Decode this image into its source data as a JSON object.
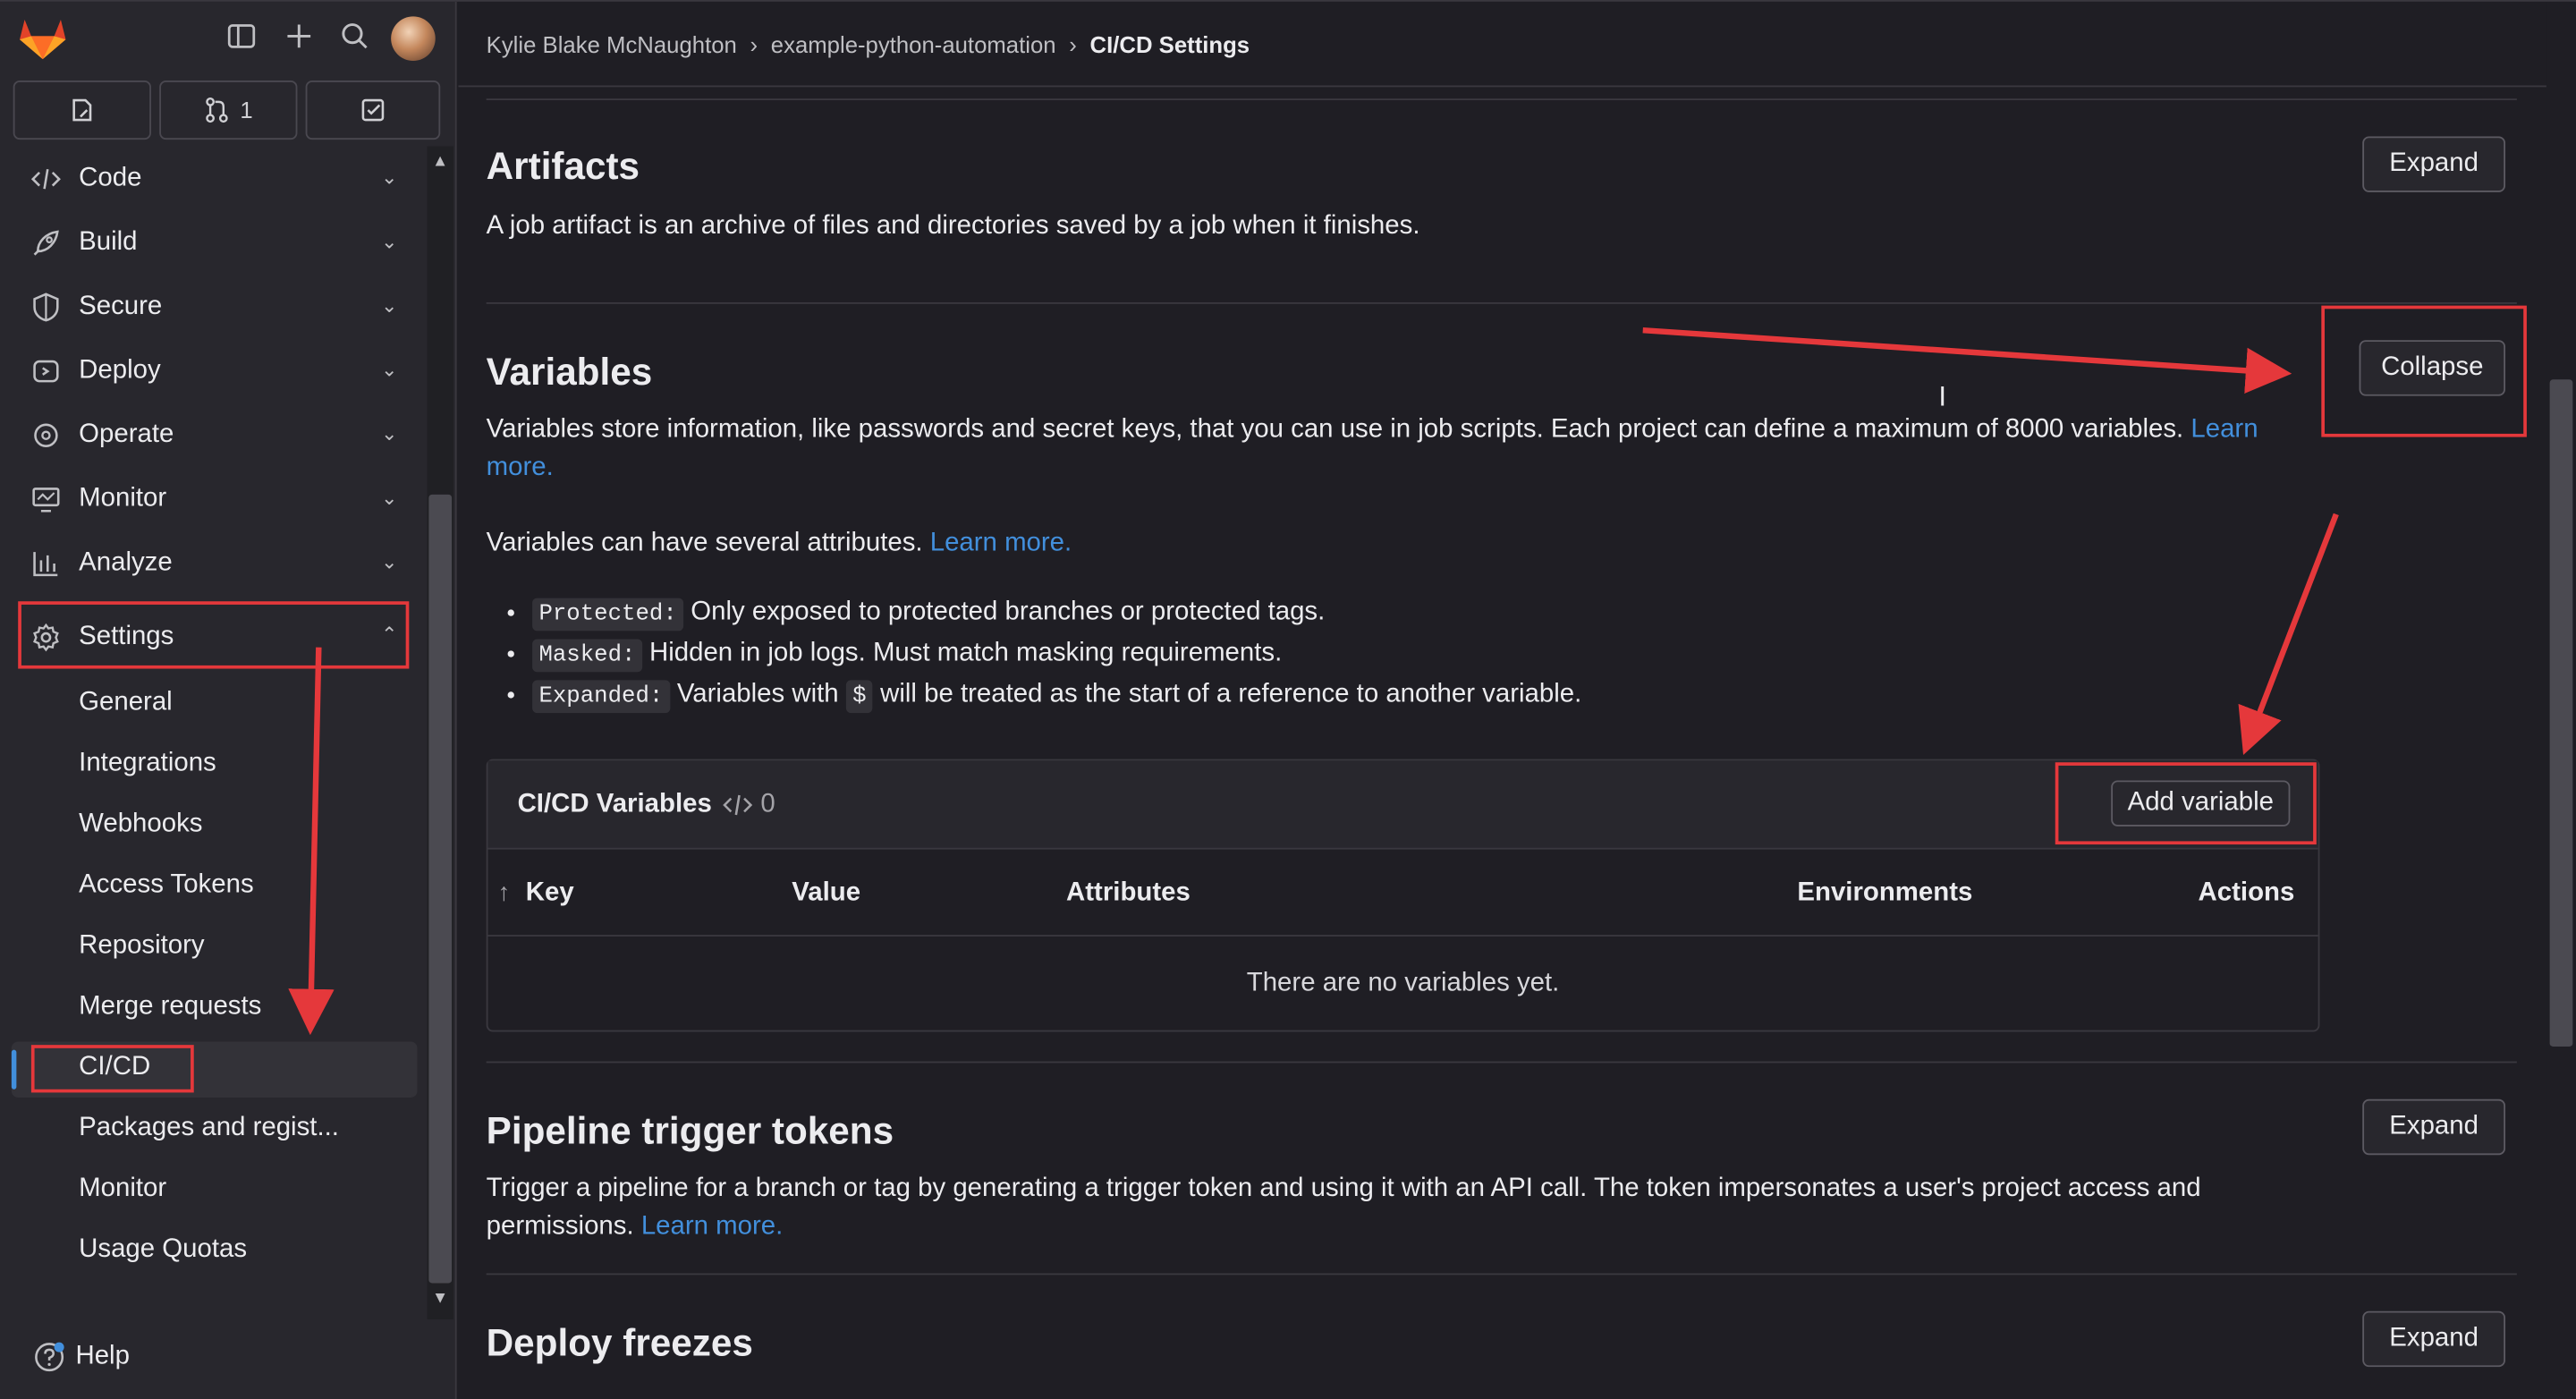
{
  "topbar": {
    "merge_requests_count": "1"
  },
  "nav": {
    "items": [
      {
        "label": "Code"
      },
      {
        "label": "Build"
      },
      {
        "label": "Secure"
      },
      {
        "label": "Deploy"
      },
      {
        "label": "Operate"
      },
      {
        "label": "Monitor"
      },
      {
        "label": "Analyze"
      },
      {
        "label": "Settings"
      }
    ],
    "settings_sub": [
      {
        "label": "General"
      },
      {
        "label": "Integrations"
      },
      {
        "label": "Webhooks"
      },
      {
        "label": "Access Tokens"
      },
      {
        "label": "Repository"
      },
      {
        "label": "Merge requests"
      },
      {
        "label": "CI/CD"
      },
      {
        "label": "Packages and regist..."
      },
      {
        "label": "Monitor"
      },
      {
        "label": "Usage Quotas"
      }
    ],
    "help": "Help"
  },
  "breadcrumb": {
    "owner": "Kylie Blake McNaughton",
    "project": "example-python-automation",
    "current": "CI/CD Settings"
  },
  "artifacts": {
    "title": "Artifacts",
    "description": "A job artifact is an archive of files and directories saved by a job when it finishes.",
    "button": "Expand"
  },
  "variables": {
    "title": "Variables",
    "description": "Variables store information, like passwords and secret keys, that you can use in job scripts. Each project can define a maximum of 8000 variables.",
    "learn_more": "Learn more.",
    "attributes_intro": "Variables can have several attributes.",
    "attributes_link": "Learn more.",
    "button": "Collapse",
    "bullets": [
      {
        "code": "Protected:",
        "text": "Only exposed to protected branches or protected tags."
      },
      {
        "code": "Masked:",
        "text": "Hidden in job logs. Must match masking requirements."
      },
      {
        "code": "Expanded:",
        "text_a": "Variables with",
        "symbol": "$",
        "text_b": "will be treated as the start of a reference to another variable."
      }
    ],
    "table": {
      "title": "CI/CD Variables",
      "count": "0",
      "add_button": "Add variable",
      "columns": {
        "key": "Key",
        "value": "Value",
        "attributes": "Attributes",
        "environments": "Environments",
        "actions": "Actions"
      },
      "empty": "There are no variables yet."
    }
  },
  "pipeline_triggers": {
    "title": "Pipeline trigger tokens",
    "description": "Trigger a pipeline for a branch or tag by generating a trigger token and using it with an API call. The token impersonates a user's project access and permissions.",
    "learn_more": "Learn more.",
    "button": "Expand"
  },
  "deploy_freezes": {
    "title": "Deploy freezes",
    "button": "Expand"
  }
}
